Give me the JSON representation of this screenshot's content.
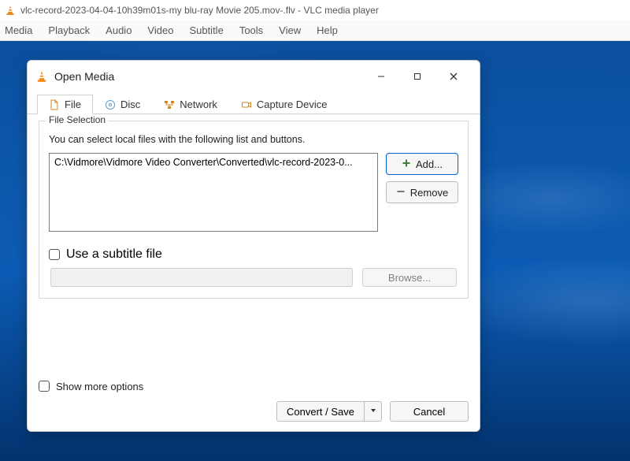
{
  "app_title": "vlc-record-2023-04-04-10h39m01s-my blu-ray Movie 205.mov-.flv - VLC media player",
  "menubar": [
    "Media",
    "Playback",
    "Audio",
    "Video",
    "Subtitle",
    "Tools",
    "View",
    "Help"
  ],
  "dialog": {
    "title": "Open Media",
    "tabs": [
      {
        "key": "file",
        "label": "File",
        "active": true
      },
      {
        "key": "disc",
        "label": "Disc",
        "active": false
      },
      {
        "key": "network",
        "label": "Network",
        "active": false
      },
      {
        "key": "capture",
        "label": "Capture Device",
        "active": false
      }
    ],
    "file_selection": {
      "legend": "File Selection",
      "hint": "You can select local files with the following list and buttons.",
      "selected_path": "C:\\Vidmore\\Vidmore Video Converter\\Converted\\vlc-record-2023-0...",
      "add_label": "Add...",
      "remove_label": "Remove"
    },
    "subtitle": {
      "checkbox_label": "Use a subtitle file",
      "browse_label": "Browse..."
    },
    "show_more_label": "Show more options",
    "primary_action": "Convert / Save",
    "cancel_label": "Cancel"
  }
}
